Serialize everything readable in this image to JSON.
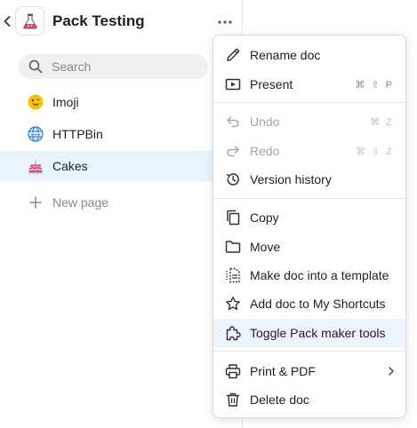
{
  "header": {
    "title": "Pack Testing"
  },
  "search": {
    "placeholder": "Search"
  },
  "sidebar": {
    "pages": [
      {
        "label": "Imoji"
      },
      {
        "label": "HTTPBin"
      },
      {
        "label": "Cakes"
      }
    ],
    "new_page_label": "New page"
  },
  "menu": {
    "items": [
      {
        "label": "Rename doc",
        "icon": "pencil-icon"
      },
      {
        "label": "Present",
        "icon": "present-icon",
        "shortcut": "⌘ ⇧ P"
      },
      {
        "label": "Undo",
        "icon": "undo-icon",
        "shortcut": "⌘ Z"
      },
      {
        "label": "Redo",
        "icon": "redo-icon",
        "shortcut": "⌘ ⇧ Z"
      },
      {
        "label": "Version history",
        "icon": "history-icon"
      },
      {
        "label": "Copy",
        "icon": "copy-icon"
      },
      {
        "label": "Move",
        "icon": "folder-icon"
      },
      {
        "label": "Make doc into a template",
        "icon": "template-icon"
      },
      {
        "label": "Add doc to My Shortcuts",
        "icon": "star-icon"
      },
      {
        "label": "Toggle Pack maker tools",
        "icon": "puzzle-icon"
      },
      {
        "label": "Print & PDF",
        "icon": "printer-icon"
      },
      {
        "label": "Delete doc",
        "icon": "trash-icon"
      }
    ]
  },
  "colors": {
    "selected_bg": "#e8f3fb",
    "highlight_bg": "#eef4fb",
    "flask_pink": "#e0407a"
  }
}
